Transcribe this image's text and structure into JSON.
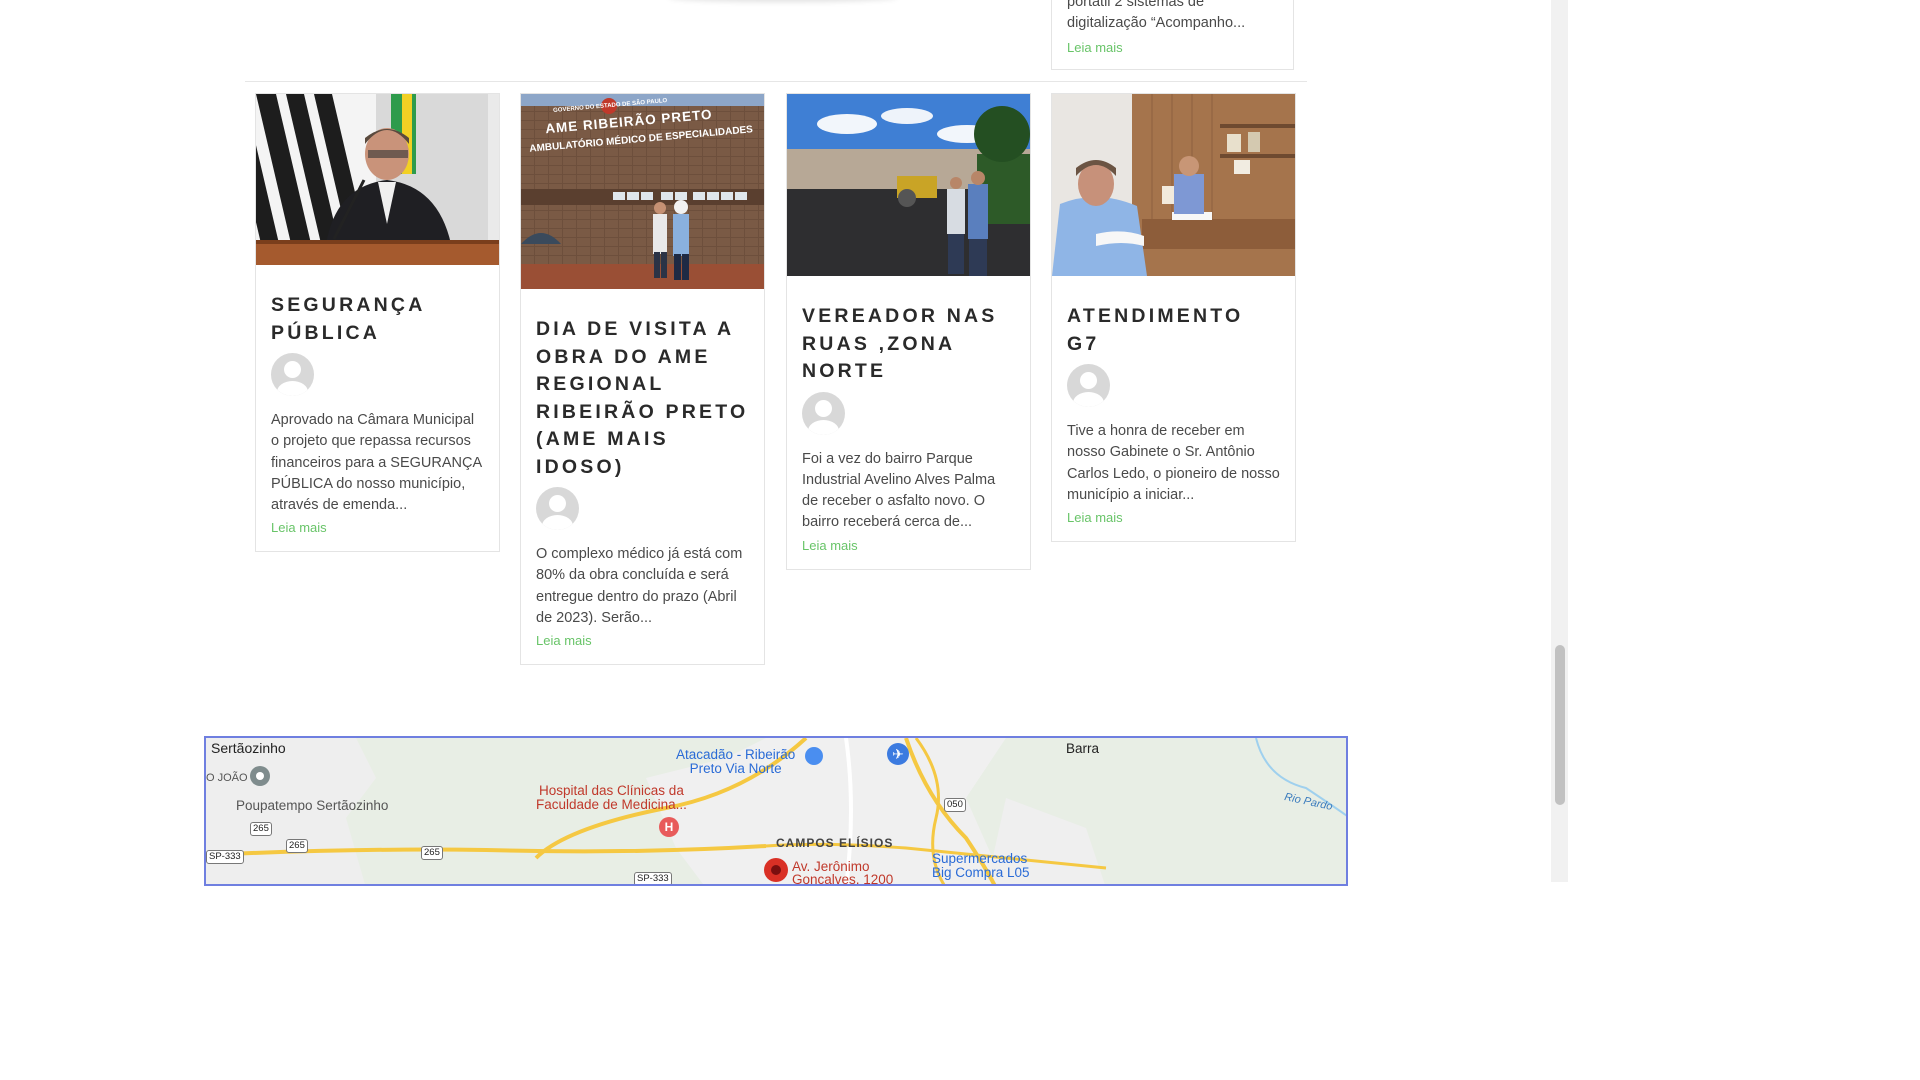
{
  "top_card": {
    "excerpt_line1": "portátil 2 sistemas de",
    "excerpt_line2": "digitalização “Acompanho...",
    "read_more": "Leia mais"
  },
  "posts": [
    {
      "title": "SEGURANÇA PÚBLICA",
      "excerpt": "Aprovado na Câmara Municipal o projeto que repassa recursos financeiros para a SEGURANÇA PÚBLICA do nosso município, através de emenda...",
      "read_more": "Leia mais"
    },
    {
      "title": "DIA DE VISITA A OBRA DO AME REGIONAL RIBEIRÃO PRETO (AME MAIS IDOSO)",
      "excerpt": "O complexo médico já está com 80% da obra concluída e será entregue dentro do prazo (Abril de 2023). Serão...",
      "read_more": "Leia mais",
      "photo_sign_top": "GOVERNO DO ESTADO DE SÃO PAULO",
      "photo_sign_main": "AME RIBEIRÃO PRETO",
      "photo_sign_sub": "AMBULATÓRIO MÉDICO DE ESPECIALIDADES"
    },
    {
      "title": "VEREADOR NAS RUAS ,ZONA NORTE",
      "excerpt": "Foi a vez do bairro Parque Industrial Avelino Alves Palma de receber o asfalto novo. O bairro receberá cerca de...",
      "read_more": "Leia mais"
    },
    {
      "title": "ATENDIMENTO G7",
      "excerpt": "Tive a honra de receber em nosso Gabinete o Sr. Antônio Carlos Ledo, o pioneiro de nosso município a iniciar...",
      "read_more": "Leia mais"
    }
  ],
  "map": {
    "labels": {
      "sertaozinho": "Sertãozinho",
      "sao_joao": "O JOÃO",
      "poupatempo": "Poupatempo Sertãozinho",
      "atacadao_1": "Atacadão - Ribeirão",
      "atacadao_2": "Preto Via Norte",
      "hospital_1": "Hospital das Clínicas da",
      "hospital_2": "Faculdade de Medicina...",
      "campos": "CAMPOS ELÍSIOS",
      "av_1": "Av. Jerônimo",
      "av_2": "Gonçalves, 1200",
      "super_1": "Supermercados",
      "super_2": "Big Compra L05",
      "barra": "Barra",
      "rio": "Rio Pardo"
    },
    "shields": {
      "s265a": "265",
      "s265b": "265",
      "s265c": "265",
      "sp333a": "SP-333",
      "sp333b": "SP-333",
      "s050": "050"
    },
    "colors": {
      "land": "#e9efe6",
      "urban": "#f1f1f1",
      "highway": "#f5c842",
      "water": "#9fd0ee",
      "pin": "#d93025"
    }
  }
}
